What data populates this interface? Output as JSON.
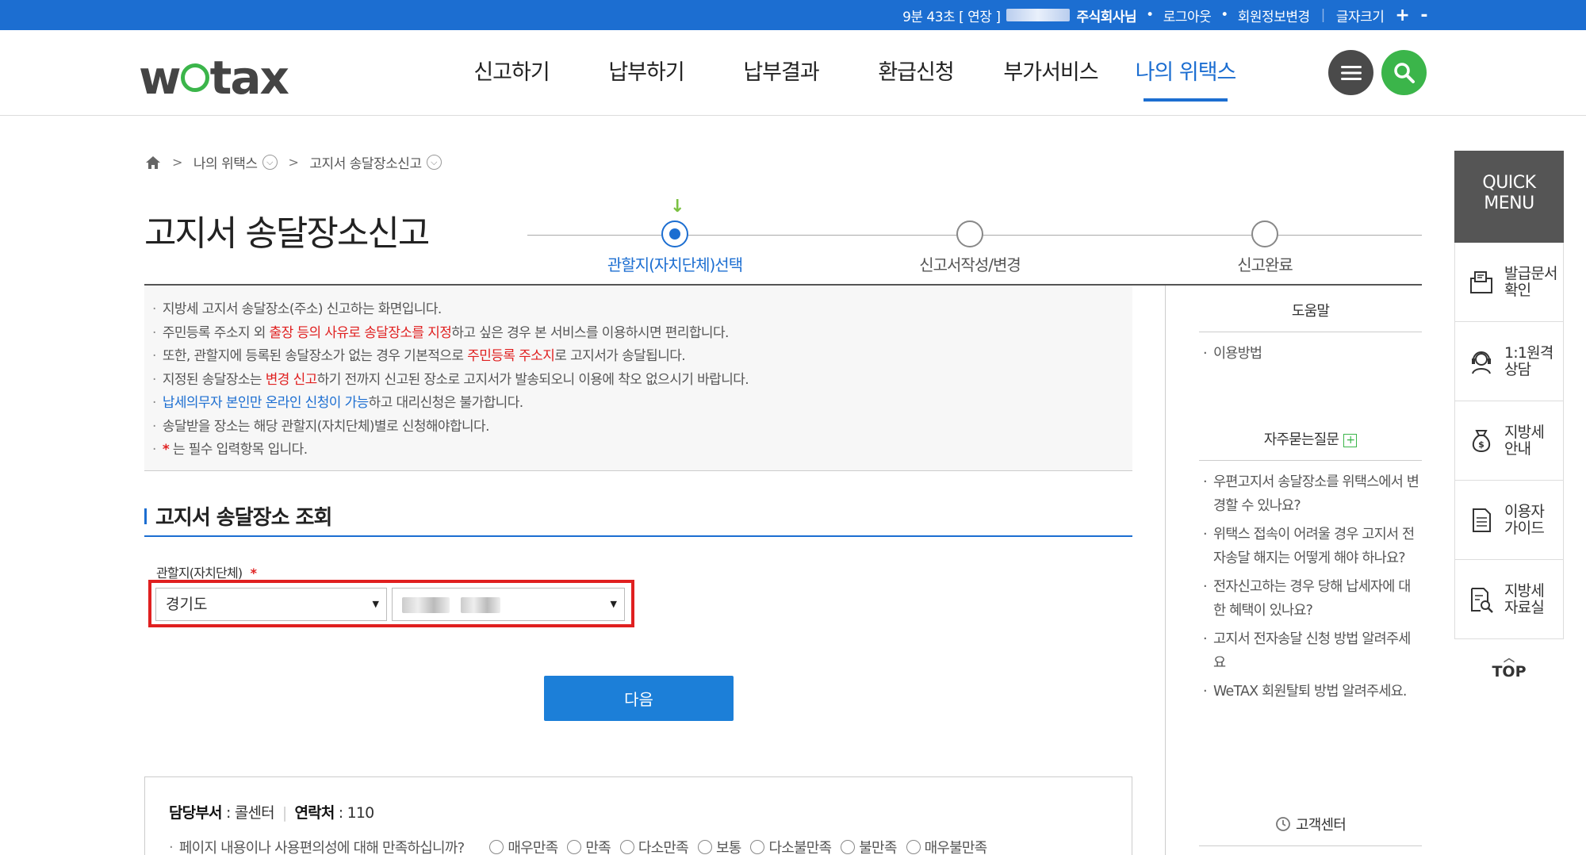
{
  "topbar": {
    "session": "9분 43초 [ 연장 ]",
    "user_suffix": "주식회사님",
    "logout": "로그아웃",
    "member_edit": "회원정보변경",
    "font_size": "글자크기",
    "font_plus": "+",
    "font_minus": "-"
  },
  "header": {
    "logo": {
      "pre": "w",
      "post": "tax"
    },
    "nav": [
      {
        "label": "신고하기"
      },
      {
        "label": "납부하기"
      },
      {
        "label": "납부결과"
      },
      {
        "label": "환급신청"
      },
      {
        "label": "부가서비스"
      },
      {
        "label": "나의 위택스"
      }
    ],
    "active_nav": "나의 위택스"
  },
  "breadcrumb": {
    "items": [
      "나의 위택스",
      "고지서 송달장소신고"
    ]
  },
  "page": {
    "title": "고지서 송달장소신고",
    "steps": [
      {
        "label": "관할지(자치단체)선택",
        "active": true
      },
      {
        "label": "신고서작성/변경",
        "active": false
      },
      {
        "label": "신고완료",
        "active": false
      }
    ],
    "arrow": "↓"
  },
  "info": {
    "line1": "지방세 고지서 송달장소(주소) 신고하는 화면입니다.",
    "line2_a": "주민등록 주소지 외 ",
    "line2_b": "출장 등의 사유로 송달장소를 지정",
    "line2_c": "하고 싶은 경우 본 서비스를 이용하시면 편리합니다.",
    "line3_a": "또한, 관할지에 등록된 송달장소가 없는 경우 기본적으로 ",
    "line3_b": "주민등록 주소지",
    "line3_c": "로 고지서가 송달됩니다.",
    "line4_a": "지정된 송달장소는 ",
    "line4_b": "변경 신고",
    "line4_c": "하기 전까지 신고된 장소로 고지서가 발송되오니 이용에 착오 없으시기 바랍니다.",
    "line5_a": "납세의무자 본인만 온라인 신청이 가능",
    "line5_b": "하고 대리신청은 불가합니다.",
    "line6": "송달받을 장소는 해당 관할지(자치단체)별로 신청해야합니다.",
    "line7_star": "*",
    "line7_text": " 는 필수 입력항목 입니다."
  },
  "form": {
    "section_title": "고지서 송달장소 조회",
    "field_label": "관할지(자치단체)",
    "required_mark": "*",
    "province_value": "경기도",
    "next_button": "다음"
  },
  "survey": {
    "dept_label": "담당부서",
    "dept_value": " : 콜센터",
    "contact_label": "연락처",
    "contact_value": " : 110",
    "question": "페이지 내용이나 사용편의성에 대해 만족하십니까?",
    "options": [
      "매우만족",
      "만족",
      "다소만족",
      "보통",
      "다소불만족",
      "불만족",
      "매우불만족"
    ]
  },
  "help": {
    "title": "도움말",
    "usage": "이용방법",
    "faq_title": "자주묻는질문",
    "faq_plus": "+",
    "faq": [
      "우편고지서 송달장소를 위택스에서 변경할 수 있나요?",
      "위택스 접속이 어려울 경우 고지서 전자송달 해지는 어떻게 해야 하나요?",
      "전자신고하는 경우 당해 납세자에 대한 혜택이 있나요?",
      "고지서 전자송달 신청 방법 알려주세요",
      "WeTAX 회원탈퇴 방법 알려주세요."
    ],
    "customer_center": "고객센터"
  },
  "quick_menu": {
    "title": "QUICK MENU",
    "items": [
      {
        "label": "발급문서 확인",
        "icon": "document-print-icon"
      },
      {
        "label": "1:1원격 상담",
        "icon": "headset-icon"
      },
      {
        "label": "지방세 안내",
        "icon": "money-bag-icon"
      },
      {
        "label": "이용자 가이드",
        "icon": "guide-doc-icon"
      },
      {
        "label": "지방세 자료실",
        "icon": "search-doc-icon"
      }
    ],
    "top": "TOP"
  },
  "colors": {
    "primary": "#1c6ed1",
    "button": "#1c7fd8",
    "accent_green": "#3bb54a",
    "highlight_red": "#e02020"
  }
}
